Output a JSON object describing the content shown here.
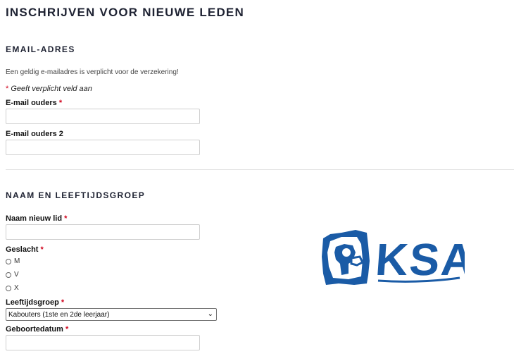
{
  "title": "INSCHRIJVEN VOOR NIEUWE LEDEN",
  "email_section": {
    "heading": "EMAIL-ADRES",
    "intro": "Een geldig e-mailadres is verplicht voor de verzekering!",
    "required_note": "Geeft verplicht veld aan",
    "required_mark": "*",
    "fields": {
      "email1_label": "E-mail ouders",
      "email2_label": "E-mail ouders 2"
    }
  },
  "name_section": {
    "heading": "NAAM EN LEEFTIJDSGROEP",
    "name_label": "Naam nieuw lid",
    "gender_label": "Geslacht",
    "gender_options": [
      "M",
      "V",
      "X"
    ],
    "age_group_label": "Leeftijdsgroep",
    "age_group_selected": "Kabouters (1ste en 2de leerjaar)",
    "birthdate_label": "Geboortedatum"
  },
  "logo": {
    "text": "KSA",
    "color": "#1a5ba6"
  }
}
